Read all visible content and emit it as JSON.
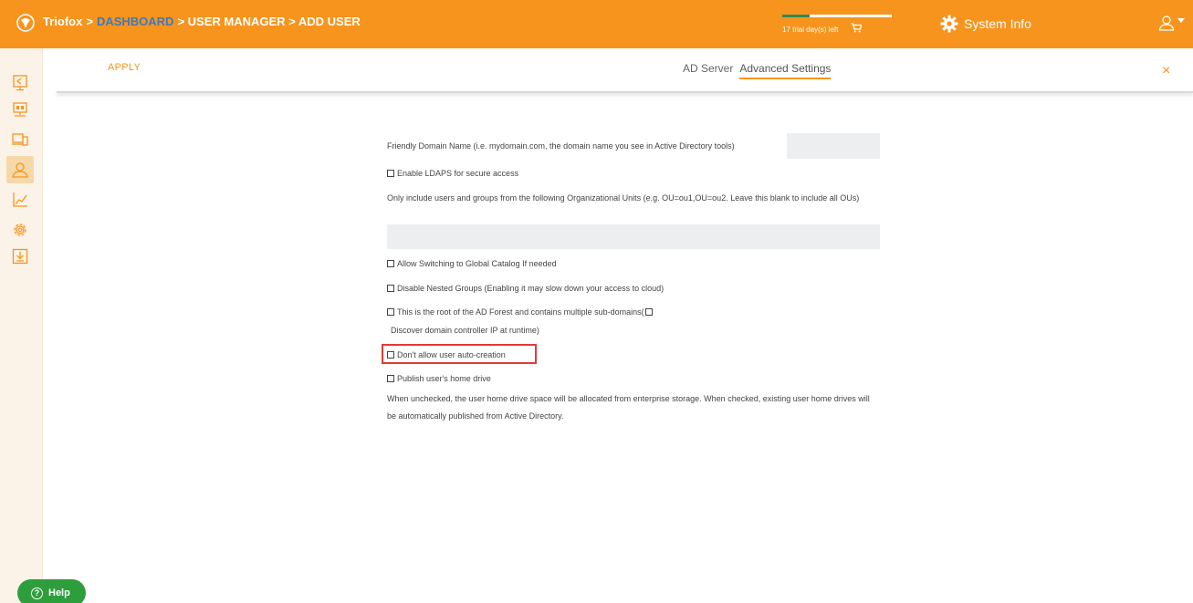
{
  "header": {
    "brand": "Triofox",
    "breadcrumb": [
      ">",
      "DASHBOARD",
      "> USER MANAGER > ADD USER"
    ],
    "trial_text": "17 trial day(s) left",
    "trial_progress": 0.25,
    "system_info": "System Info",
    "colors": {
      "bar": "#f7941d",
      "link": "#3a79c4"
    }
  },
  "sidebar": {
    "items": [
      {
        "icon": "dashboard-icon"
      },
      {
        "icon": "cloud-server-icon"
      },
      {
        "icon": "devices-icon"
      },
      {
        "icon": "users-icon",
        "active": true
      },
      {
        "icon": "reports-chart-icon"
      },
      {
        "icon": "settings-gear-icon"
      },
      {
        "icon": "download-icon"
      }
    ],
    "help_label": "Help"
  },
  "toolbar": {
    "apply_label": "APPLY",
    "tabs": [
      {
        "label": "AD Server",
        "active": false
      },
      {
        "label": "Advanced Settings",
        "active": true
      }
    ],
    "close_label": "×"
  },
  "form": {
    "friendly_domain_label": "Friendly Domain Name (i.e. mydomain.com, the domain name you see in Active Directory tools)",
    "friendly_domain_value": "",
    "enable_ldaps": "Enable LDAPS for secure access",
    "ou_label": "Only include users and groups from the following Organizational Units (e.g. OU=ou1,OU=ou2. Leave this blank to include all OUs)",
    "ou_value": "",
    "global_catalog": "Allow Switching to Global Catalog If needed",
    "disable_nested": "Disable Nested Groups (Enabling it may slow down your access to cloud)",
    "ad_forest_root": "This is the root of the AD Forest and contains multiple sub-domains(",
    "discover_dc": "Discover domain controller IP at runtime)",
    "no_auto_creation": "Don't allow user auto-creation",
    "publish_home": "Publish user's home drive",
    "publish_home_desc": "When unchecked, the user home drive space will be allocated from enterprise storage. When checked, existing user home drives will be automatically published from Active Directory."
  }
}
